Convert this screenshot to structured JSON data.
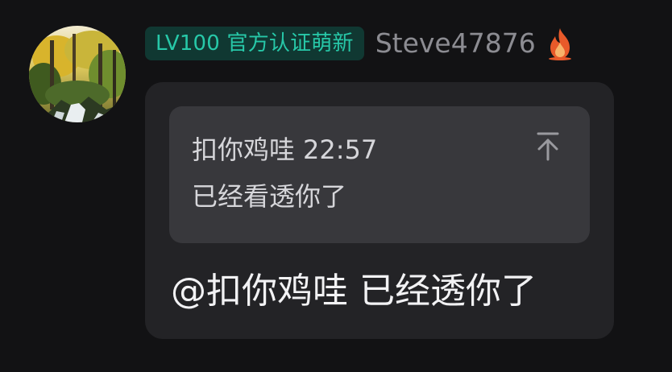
{
  "user": {
    "badge": "LV100 官方认证萌新",
    "name": "Steve47876",
    "avatar_icon": "forest-waterfall-avatar",
    "status_icon": "flame-icon"
  },
  "quote": {
    "author": "扣你鸡哇",
    "time": "22:57",
    "text": "已经看透你了",
    "jump_icon": "jump-to-top-icon"
  },
  "message": {
    "mention": "@扣你鸡哇",
    "text": "已经透你了"
  },
  "colors": {
    "background": "#121214",
    "bubble": "#232326",
    "quote_card": "#38383c",
    "badge_bg": "#103832",
    "badge_text": "#27c8a8",
    "username": "#8c8c92",
    "flame": "#e85a2a"
  }
}
